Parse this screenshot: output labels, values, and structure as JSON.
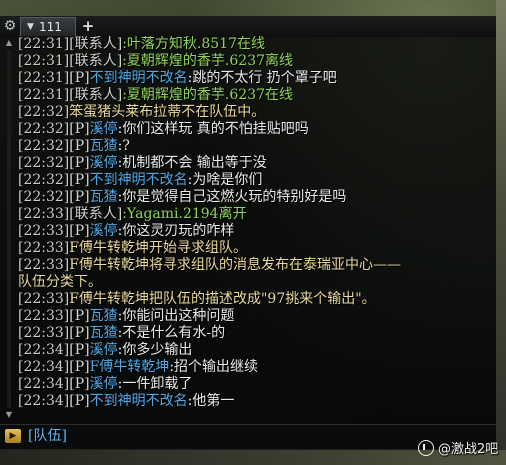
{
  "tabs": [
    {
      "label": "111",
      "selected": true
    }
  ],
  "icons": {
    "settings": "gear-icon",
    "tab_menu": "caret-down-icon",
    "add_tab": "plus-icon",
    "scroll_up": "arrow-up-icon",
    "scroll_down": "arrow-down-icon",
    "input_toggle": "triangle-right-icon"
  },
  "glyphs": {
    "gear": "⚙",
    "caret": "▼",
    "plus": "+",
    "up": "▲",
    "down": "▼",
    "play": "▶"
  },
  "chat": {
    "lines": [
      {
        "ts": "[22:31]",
        "channel": "[联系人]",
        "name": ":叶落方知秋.8517",
        "name_color": "green",
        "msg": "在线",
        "msg_style": "normal"
      },
      {
        "ts": "[22:31]",
        "channel": "[联系人]",
        "name": ":夏朝辉煌的香芋.6237",
        "name_color": "green",
        "msg": "离线",
        "msg_style": "normal"
      },
      {
        "ts": "[22:31]",
        "channel": "[P]",
        "name": "不到神明不改名",
        "name_color": "blue",
        "msg": ":跳的不太行 扔个罩子吧",
        "msg_style": "normal"
      },
      {
        "ts": "[22:31]",
        "channel": "[联系人]",
        "name": ":夏朝辉煌的香芋.6237",
        "name_color": "green",
        "msg": "在线",
        "msg_style": "normal"
      },
      {
        "ts": "[22:32]",
        "channel": "",
        "name": "",
        "name_color": "",
        "msg": "笨蛋猪头莱布拉蒂不在队伍中。",
        "msg_style": "system"
      },
      {
        "ts": "[22:32]",
        "channel": "[P]",
        "name": "溪停",
        "name_color": "blue",
        "msg": ":你们这样玩  真的不怕挂贴吧吗",
        "msg_style": "normal"
      },
      {
        "ts": "[22:32]",
        "channel": "[P]",
        "name": "瓦猹",
        "name_color": "blue",
        "msg": ":?",
        "msg_style": "normal"
      },
      {
        "ts": "[22:32]",
        "channel": "[P]",
        "name": "溪停",
        "name_color": "blue",
        "msg": ":机制都不会 输出等于没",
        "msg_style": "normal"
      },
      {
        "ts": "[22:32]",
        "channel": "[P]",
        "name": "不到神明不改名",
        "name_color": "blue",
        "msg": ":为啥是你们",
        "msg_style": "normal"
      },
      {
        "ts": "[22:32]",
        "channel": "[P]",
        "name": "瓦猹",
        "name_color": "blue",
        "msg": ":你是觉得自己这燃火玩的特别好是吗",
        "msg_style": "normal"
      },
      {
        "ts": "[22:33]",
        "channel": "[联系人]",
        "name": ":Yagami.2194",
        "name_color": "green",
        "msg": "离开",
        "msg_style": "normal"
      },
      {
        "ts": "[22:33]",
        "channel": "[P]",
        "name": "溪停",
        "name_color": "blue",
        "msg": ":你这灵刃玩的咋样",
        "msg_style": "normal"
      },
      {
        "ts": "[22:33]",
        "channel": "",
        "name": "",
        "name_color": "",
        "msg": "F傅牛转乾坤开始寻求组队。",
        "msg_style": "system"
      },
      {
        "ts": "[22:33]",
        "channel": "",
        "name": "",
        "name_color": "",
        "msg": "F傅牛转乾坤将寻求组队的消息发布在泰瑞亚中心——",
        "msg_style": "system"
      },
      {
        "ts": "",
        "channel": "",
        "name": "",
        "name_color": "",
        "msg": "队伍分类下。",
        "msg_style": "system"
      },
      {
        "ts": "[22:33]",
        "channel": "",
        "name": "",
        "name_color": "",
        "msg": "F傅牛转乾坤把队伍的描述改成\"97挑来个输出\"。",
        "msg_style": "system"
      },
      {
        "ts": "[22:33]",
        "channel": "[P]",
        "name": "瓦猹",
        "name_color": "blue",
        "msg": ":你能问出这种问题",
        "msg_style": "normal"
      },
      {
        "ts": "[22:33]",
        "channel": "[P]",
        "name": "瓦猹",
        "name_color": "blue",
        "msg": ":不是什么有水-的",
        "msg_style": "normal"
      },
      {
        "ts": "[22:34]",
        "channel": "[P]",
        "name": "溪停",
        "name_color": "blue",
        "msg": ":你多少输出",
        "msg_style": "normal"
      },
      {
        "ts": "[22:34]",
        "channel": "[P]",
        "name": "F傅牛转乾坤",
        "name_color": "blue",
        "msg": ":招个输出继续",
        "msg_style": "normal"
      },
      {
        "ts": "[22:34]",
        "channel": "[P]",
        "name": "溪停",
        "name_color": "blue",
        "msg": ":一件卸载了",
        "msg_style": "normal"
      },
      {
        "ts": "[22:34]",
        "channel": "[P]",
        "name": "不到神明不改名",
        "name_color": "blue",
        "msg": ":他第一",
        "msg_style": "normal"
      }
    ]
  },
  "input": {
    "channel_label": "[队伍]"
  },
  "watermark": {
    "text": "@激战2吧"
  }
}
